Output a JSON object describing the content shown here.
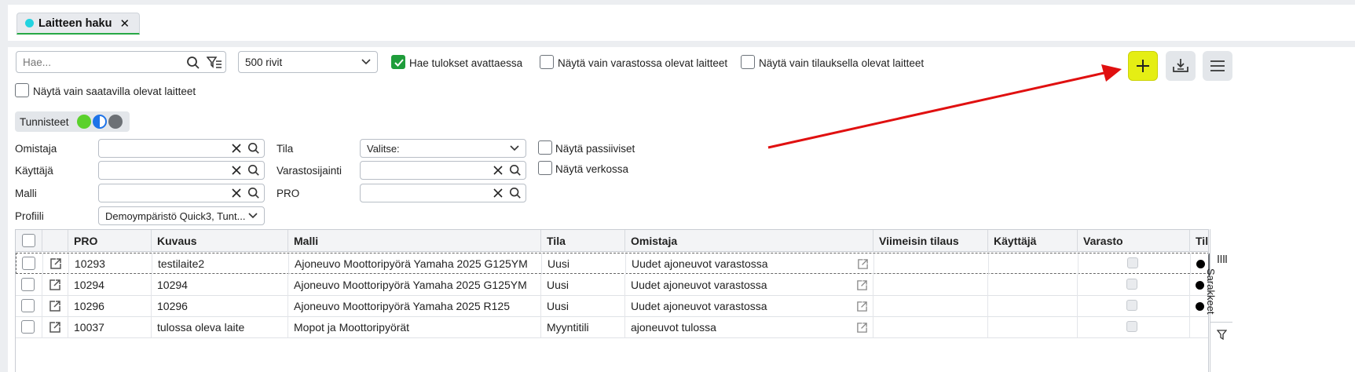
{
  "tab": {
    "label": "Laitteen haku",
    "close": "✕",
    "dot_color": "#22d3e0"
  },
  "search": {
    "placeholder": "Hae..."
  },
  "rows_select": {
    "value": "500 rivit"
  },
  "checkboxes_top": [
    {
      "label": "Hae tulokset avattaessa",
      "checked": true
    },
    {
      "label": "Näytä vain varastossa olevat laitteet",
      "checked": false
    },
    {
      "label": "Näytä vain tilauksella olevat laitteet",
      "checked": false
    },
    {
      "label": "Näytä vain saatavilla olevat laitteet",
      "checked": false
    }
  ],
  "toolbar": {
    "add": "add-icon",
    "export": "download-icon",
    "menu": "menu-icon",
    "accent": "#e5ee14"
  },
  "tags": {
    "label": "Tunnisteet",
    "colors": [
      "#5bd12c",
      "#1e73e8",
      "#6c7075"
    ]
  },
  "filters": {
    "owner": "Omistaja",
    "user": "Käyttäjä",
    "model": "Malli",
    "profile": "Profiili",
    "profile_value": "Demoympäristö Quick3, Tunt...",
    "status": "Tila",
    "status_value": "Valitse:",
    "location": "Varastosijainti",
    "pro": "PRO",
    "show_passive": "Näytä passiiviset",
    "show_network": "Näytä verkossa"
  },
  "table": {
    "columns": [
      "PRO",
      "Kuvaus",
      "Malli",
      "Tila",
      "Omistaja",
      "Viimeisin tilaus",
      "Käyttäjä",
      "Varasto",
      "Tila"
    ],
    "rows": [
      {
        "pro": "10293",
        "desc": "testilaite2",
        "model": "Ajoneuvo Moottoripyörä Yamaha 2025 G125YM",
        "status": "Uusi",
        "owner": "Uudet ajoneuvot varastossa"
      },
      {
        "pro": "10294",
        "desc": "10294",
        "model": "Ajoneuvo Moottoripyörä Yamaha 2025 G125YM",
        "status": "Uusi",
        "owner": "Uudet ajoneuvot varastossa"
      },
      {
        "pro": "10296",
        "desc": "10296",
        "model": "Ajoneuvo Moottoripyörä Yamaha 2025 R125",
        "status": "Uusi",
        "owner": "Uudet ajoneuvot varastossa"
      },
      {
        "pro": "10037",
        "desc": "tulossa oleva laite",
        "model": "Mopot ja Moottoripyörät",
        "status": "Myyntitili",
        "owner": "ajoneuvot tulossa"
      }
    ]
  },
  "side_panel": {
    "columns_label": "Sarakkeet"
  }
}
